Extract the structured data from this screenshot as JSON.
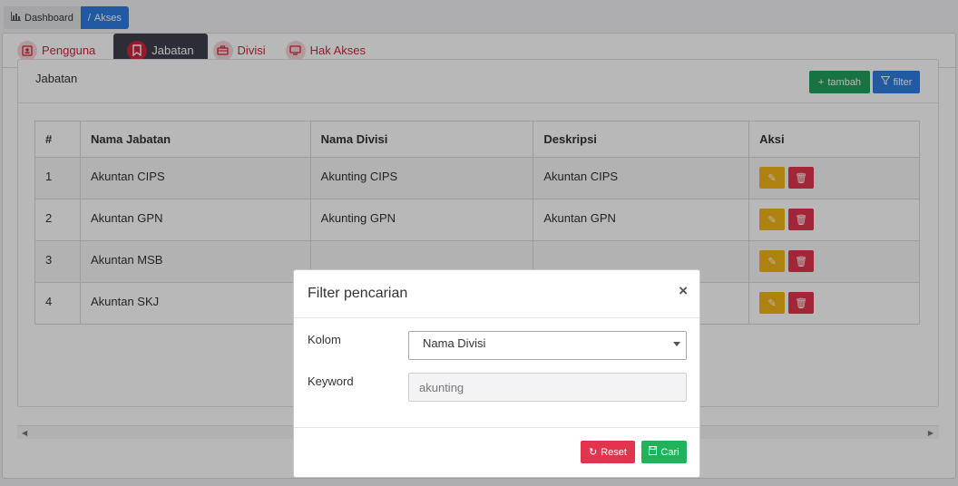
{
  "breadcrumb": [
    {
      "label": "Dashboard",
      "icon": "bar-chart-icon"
    },
    {
      "label": "Akses",
      "icon": "slash-icon"
    }
  ],
  "tabs": [
    {
      "label": "Pengguna",
      "icon": "user-icon",
      "active": false
    },
    {
      "label": "Jabatan",
      "icon": "bookmark-icon",
      "active": true
    },
    {
      "label": "Divisi",
      "icon": "briefcase-icon",
      "active": false
    },
    {
      "label": "Hak Akses",
      "icon": "monitor-icon",
      "active": false
    }
  ],
  "panel": {
    "title": "Jabatan",
    "add_label": "tambah",
    "filter_label": "filter"
  },
  "table": {
    "headers": [
      "#",
      "Nama Jabatan",
      "Nama Divisi",
      "Deskripsi",
      "Aksi"
    ],
    "rows": [
      {
        "no": "1",
        "jabatan": "Akuntan CIPS",
        "divisi": "Akunting CIPS",
        "deskripsi": "Akuntan CIPS"
      },
      {
        "no": "2",
        "jabatan": "Akuntan GPN",
        "divisi": "Akunting GPN",
        "deskripsi": "Akuntan GPN"
      },
      {
        "no": "3",
        "jabatan": "Akuntan MSB",
        "divisi": "",
        "deskripsi": ""
      },
      {
        "no": "4",
        "jabatan": "Akuntan SKJ",
        "divisi": "",
        "deskripsi": ""
      }
    ]
  },
  "modal": {
    "title": "Filter pencarian",
    "close_symbol": "×",
    "kolom_label": "Kolom",
    "kolom_value": "Nama Divisi",
    "keyword_label": "Keyword",
    "keyword_value": "akunting",
    "reset_label": "Reset",
    "cari_label": "Cari"
  },
  "colors": {
    "primary": "#2f7de1",
    "success": "#21a05a",
    "danger": "#e2344e",
    "warning": "#f0b416",
    "tab_active_bg": "#3d3f4b",
    "tab_text": "#d0243f"
  }
}
